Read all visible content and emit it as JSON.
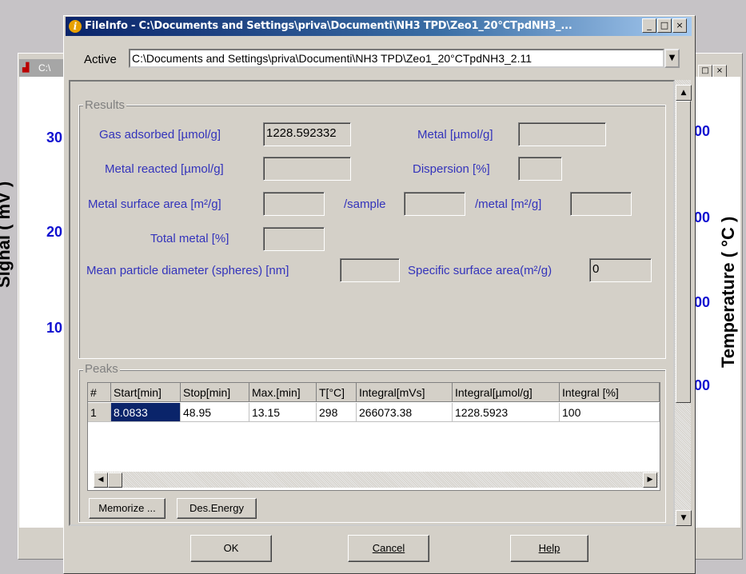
{
  "background_window": {
    "title_fragment": "C:\\",
    "left_ticks": [
      "30",
      "20",
      "10"
    ],
    "right_ticks": [
      "00",
      "00",
      "00",
      "00"
    ],
    "left_axis_label": "Signal ( mV )",
    "right_axis_label": "Temperature ( °C )"
  },
  "dialog": {
    "title": "FileInfo - C:\\Documents and Settings\\priva\\Documenti\\NH3 TPD\\Zeo1_20°CTpdNH3_...",
    "active_label": "Active",
    "active_value": "C:\\Documents and Settings\\priva\\Documenti\\NH3 TPD\\Zeo1_20°CTpdNH3_2.11"
  },
  "results": {
    "legend": "Results",
    "gas_adsorbed_label": "Gas adsorbed [µmol/g]",
    "gas_adsorbed_value": "1228.592332",
    "metal_label": "Metal [µmol/g]",
    "metal_value": "",
    "metal_reacted_label": "Metal reacted [µmol/g]",
    "metal_reacted_value": "",
    "dispersion_label": "Dispersion [%]",
    "dispersion_value": "",
    "metal_surface_label": "Metal surface area [m²/g]",
    "metal_surface_value": "",
    "per_sample_label": "/sample",
    "per_sample_value": "",
    "per_metal_label": "/metal [m²/g]",
    "per_metal_value": "",
    "total_metal_label": "Total  metal [%]",
    "total_metal_value": "",
    "mean_particle_label": "Mean particle diameter (spheres) [nm]",
    "mean_particle_value": "",
    "specific_surface_label": "Specific surface area(m²/g)",
    "specific_surface_value": "0"
  },
  "peaks": {
    "legend": "Peaks",
    "columns": [
      "#",
      "Start[min]",
      "Stop[min]",
      "Max.[min]",
      "T[°C]",
      "Integral[mVs]",
      "Integral[µmol/g]",
      "Integral [%]"
    ],
    "rows": [
      [
        "1",
        "8.0833",
        "48.95",
        "13.15",
        "298",
        "266073.38",
        "1228.5923",
        "100"
      ]
    ],
    "memorize_label": "Memorize ...",
    "des_energy_label": "Des.Energy"
  },
  "footer": {
    "ok_label": "OK",
    "cancel_label": "Cancel",
    "help_label": "Help"
  },
  "icons": {
    "info": "info-icon",
    "minimize": "minimize-icon",
    "maximize": "maximize-icon",
    "close": "close-icon",
    "dropdown": "chevron-down-icon"
  }
}
